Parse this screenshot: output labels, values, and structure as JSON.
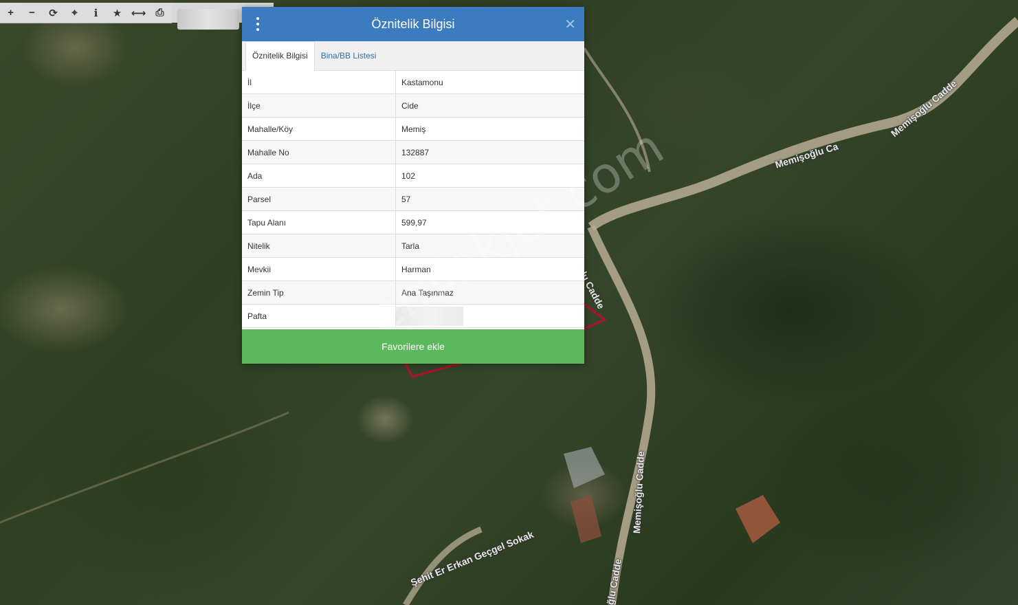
{
  "toolbar": {
    "buttons": [
      {
        "icon": "zoom-in-icon",
        "glyph": "+"
      },
      {
        "icon": "zoom-out-icon",
        "glyph": "−"
      },
      {
        "icon": "refresh-icon",
        "glyph": "⟳"
      },
      {
        "icon": "locate-icon",
        "glyph": "⌖"
      },
      {
        "icon": "info-icon",
        "glyph": "i"
      },
      {
        "icon": "star-icon",
        "glyph": "★"
      },
      {
        "icon": "measure-icon",
        "glyph": "⟷"
      },
      {
        "icon": "print-icon",
        "glyph": "⎙"
      }
    ]
  },
  "map": {
    "road_labels": [
      "Memişoğlu Cadde",
      "Memişoğlu Ca",
      "lu Cadde",
      "Memişoğlu Cadde",
      "oğlu Cadde",
      "Şehit Er Erkan Geçgel Sokak"
    ],
    "watermark": "emlakjet.com",
    "parcel_border_color": "#b0102a"
  },
  "popup": {
    "title": "Öznitelik Bilgisi",
    "header_color": "#3b7bbf",
    "tabs": [
      {
        "label": "Öznitelik Bilgisi",
        "active": true
      },
      {
        "label": "Bina/BB Listesi",
        "active": false
      }
    ],
    "rows": [
      {
        "key": "İl",
        "value": "Kastamonu"
      },
      {
        "key": "İlçe",
        "value": "Cide"
      },
      {
        "key": "Mahalle/Köy",
        "value": "Memiş"
      },
      {
        "key": "Mahalle No",
        "value": "132887"
      },
      {
        "key": "Ada",
        "value": "102"
      },
      {
        "key": "Parsel",
        "value": "57"
      },
      {
        "key": "Tapu Alanı",
        "value": "599,97"
      },
      {
        "key": "Nitelik",
        "value": "Tarla"
      },
      {
        "key": "Mevkii",
        "value": "Harman"
      },
      {
        "key": "Zemin Tip",
        "value": "Ana Taşınmaz"
      },
      {
        "key": "Pafta",
        "value": ""
      }
    ],
    "favorite_label": "Favorilere ekle",
    "favorite_color": "#5cb85c"
  }
}
